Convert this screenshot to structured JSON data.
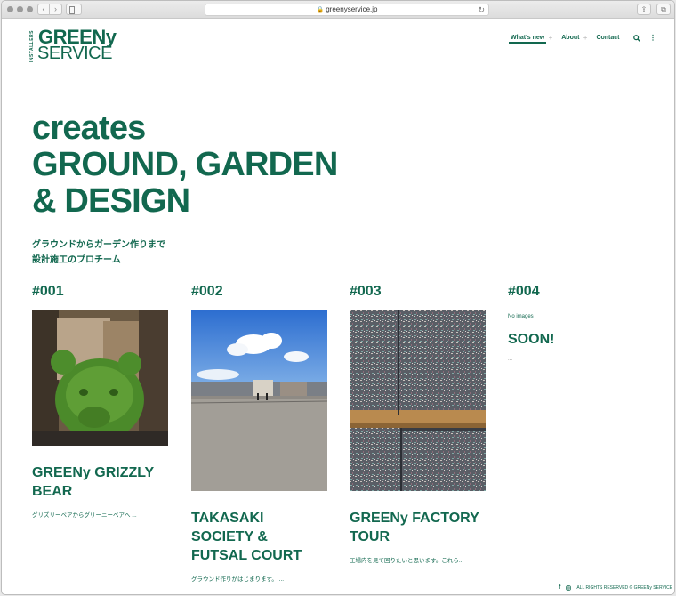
{
  "browser": {
    "url": "greenyservice.jp"
  },
  "logo": {
    "side_text": "INSTALLERS",
    "top_text": "GREENy",
    "bottom_text": "SERVICE"
  },
  "nav": {
    "items": [
      {
        "label": "What's new"
      },
      {
        "label": "About"
      },
      {
        "label": "Contact"
      }
    ]
  },
  "hero": {
    "line1": "creates",
    "line2": "GROUND, GARDEN",
    "line3": "& DESIGN"
  },
  "subtitle": {
    "line1": "グラウンドからガーデン作りまで",
    "line2": "設計施工のプロチーム"
  },
  "cards": [
    {
      "num": "#001",
      "title_lines": [
        "GREENy GRIZZLY",
        "BEAR"
      ],
      "excerpt": "グリズリーベアからグリーニーベアへ ..."
    },
    {
      "num": "#002",
      "title_lines": [
        "TAKASAKI",
        "SOCIETY &",
        "FUTSAL COURT"
      ],
      "excerpt": "グラウンド作りがはじまります。 ..."
    },
    {
      "num": "#003",
      "title_lines": [
        "GREENy FACTORY",
        "TOUR"
      ],
      "excerpt": "工場内を見て回りたいと思います。これら..."
    },
    {
      "num": "#004",
      "no_images": "No images",
      "soon": "SOON!",
      "ellipsis": "..."
    }
  ],
  "footer": {
    "copyright": "ALL RIGHTS RESERVED © GREENy SERVICE"
  },
  "colors": {
    "brand": "#12684f"
  }
}
